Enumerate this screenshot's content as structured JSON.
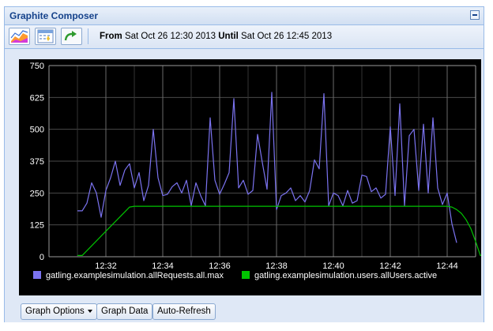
{
  "window": {
    "title": "Graphite Composer"
  },
  "toolbar": {
    "from_label": "From",
    "from_value": "Sat Oct 26 12:30 2013",
    "until_label": "Until",
    "until_value": "Sat Oct 26 12:45 2013",
    "icons": [
      "graph-thumbnail-icon",
      "calendar-icon",
      "refresh-arrow-icon"
    ]
  },
  "buttons": {
    "graph_options": "Graph Options",
    "graph_data": "Graph Data",
    "auto_refresh": "Auto-Refresh"
  },
  "chart_data": {
    "type": "line",
    "background": "#000000",
    "grid": true,
    "legend_position": "bottom",
    "ylim": [
      0,
      750
    ],
    "yticks": [
      "0",
      "125",
      "250",
      "375",
      "500",
      "625",
      "750"
    ],
    "xlim": [
      "12:30",
      "12:45"
    ],
    "xticks": [
      "12:32",
      "12:34",
      "12:36",
      "12:38",
      "12:40",
      "12:42",
      "12:44"
    ],
    "series": [
      {
        "name": "gatling.examplesimulation.allRequests.all.max",
        "color": "#7b73f0",
        "x": [
          "12:31:00",
          "12:31:10",
          "12:31:20",
          "12:31:30",
          "12:31:40",
          "12:31:50",
          "12:32:00",
          "12:32:10",
          "12:32:20",
          "12:32:30",
          "12:32:40",
          "12:32:50",
          "12:33:00",
          "12:33:10",
          "12:33:20",
          "12:33:30",
          "12:33:40",
          "12:33:50",
          "12:34:00",
          "12:34:10",
          "12:34:20",
          "12:34:30",
          "12:34:40",
          "12:34:50",
          "12:35:00",
          "12:35:10",
          "12:35:20",
          "12:35:30",
          "12:35:40",
          "12:35:50",
          "12:36:00",
          "12:36:10",
          "12:36:20",
          "12:36:30",
          "12:36:40",
          "12:36:50",
          "12:37:00",
          "12:37:10",
          "12:37:20",
          "12:37:30",
          "12:37:40",
          "12:37:50",
          "12:38:00",
          "12:38:10",
          "12:38:20",
          "12:38:30",
          "12:38:40",
          "12:38:50",
          "12:39:00",
          "12:39:10",
          "12:39:20",
          "12:39:30",
          "12:39:40",
          "12:39:50",
          "12:40:00",
          "12:40:10",
          "12:40:20",
          "12:40:30",
          "12:40:40",
          "12:40:50",
          "12:41:00",
          "12:41:10",
          "12:41:20",
          "12:41:30",
          "12:41:40",
          "12:41:50",
          "12:42:00",
          "12:42:10",
          "12:42:20",
          "12:42:30",
          "12:42:40",
          "12:42:50",
          "12:43:00",
          "12:43:10",
          "12:43:20",
          "12:43:30",
          "12:43:40",
          "12:43:50",
          "12:44:00",
          "12:44:10",
          "12:44:20"
        ],
        "values": [
          180,
          180,
          210,
          290,
          250,
          155,
          260,
          310,
          375,
          280,
          340,
          365,
          270,
          330,
          220,
          280,
          500,
          310,
          240,
          245,
          275,
          290,
          250,
          300,
          200,
          290,
          240,
          200,
          545,
          300,
          245,
          285,
          330,
          620,
          270,
          300,
          245,
          260,
          480,
          370,
          265,
          645,
          185,
          240,
          250,
          270,
          220,
          240,
          215,
          260,
          380,
          345,
          640,
          200,
          250,
          240,
          200,
          260,
          210,
          220,
          320,
          315,
          255,
          270,
          230,
          245,
          510,
          240,
          600,
          200,
          475,
          500,
          260,
          520,
          250,
          545,
          270,
          205,
          250,
          130,
          55
        ]
      },
      {
        "name": "gatling.examplesimulation.users.allUsers.active",
        "color": "#00c400",
        "x": [
          "12:31:00",
          "12:31:10",
          "12:32:50",
          "12:33:00",
          "12:44:00",
          "12:44:10",
          "12:44:20",
          "12:44:30",
          "12:44:40",
          "12:44:50",
          "12:45:00",
          "12:45:10",
          "12:45:20",
          "12:45:30"
        ],
        "values": [
          5,
          5,
          195,
          198,
          198,
          195,
          185,
          170,
          145,
          110,
          60,
          5,
          5,
          5
        ]
      }
    ]
  }
}
